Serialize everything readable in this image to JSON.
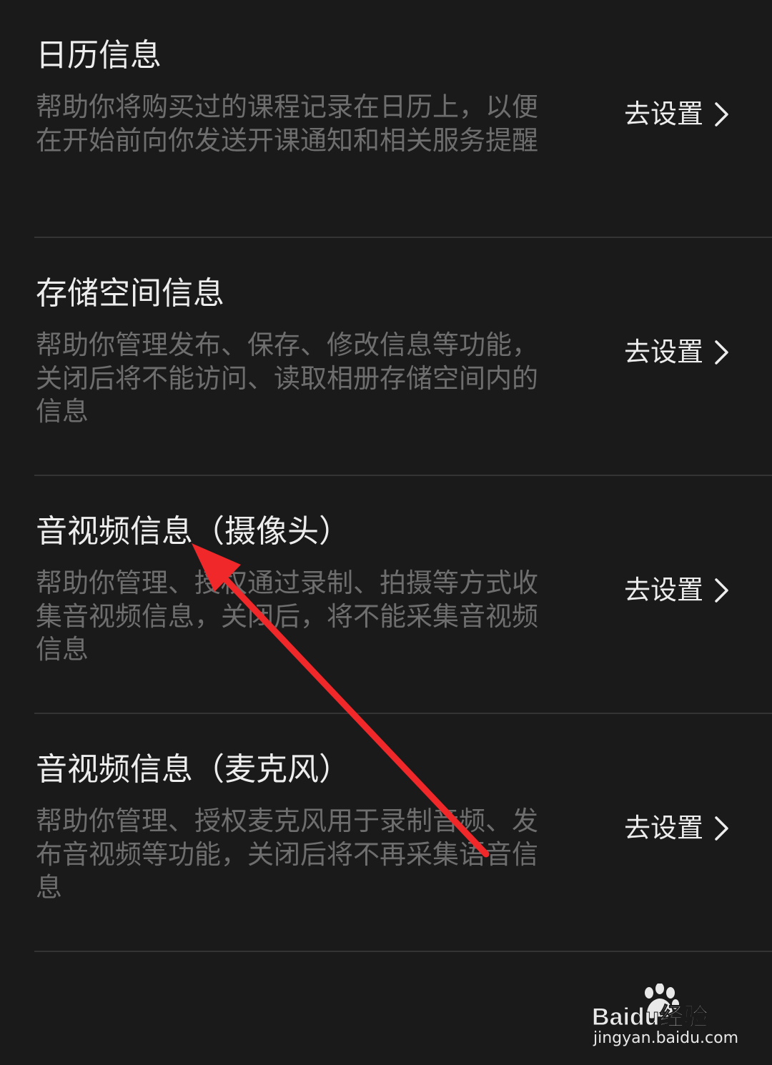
{
  "sections": [
    {
      "title": "日历信息",
      "description": "帮助你将购买过的课程记录在日历上，以便在开始前向你发送开课通知和相关服务提醒",
      "action_label": "去设置"
    },
    {
      "title": "存储空间信息",
      "description": "帮助你管理发布、保存、修改信息等功能，关闭后将不能访问、读取相册存储空间内的信息",
      "action_label": "去设置"
    },
    {
      "title": "音视频信息（摄像头）",
      "description": "帮助你管理、授权通过录制、拍摄等方式收集音视频信息，关闭后，将不能采集音视频信息",
      "action_label": "去设置"
    },
    {
      "title": "音视频信息（麦克风）",
      "description": "帮助你管理、授权麦克风用于录制音频、发布音视频等功能，关闭后将不再采集语音信息",
      "action_label": "去设置"
    }
  ],
  "watermark": {
    "logo_text": "Baidu经验",
    "url": "jingyan.baidu.com"
  },
  "colors": {
    "background": "#1a1a1a",
    "title": "#ededed",
    "description": "#6e6e6e",
    "divider": "#343434",
    "annotation": "#f0282a"
  },
  "icons": {
    "action": "chevron-right-icon",
    "annotation": "arrow-annotation-icon",
    "watermark": "baidu-paw-icon"
  }
}
